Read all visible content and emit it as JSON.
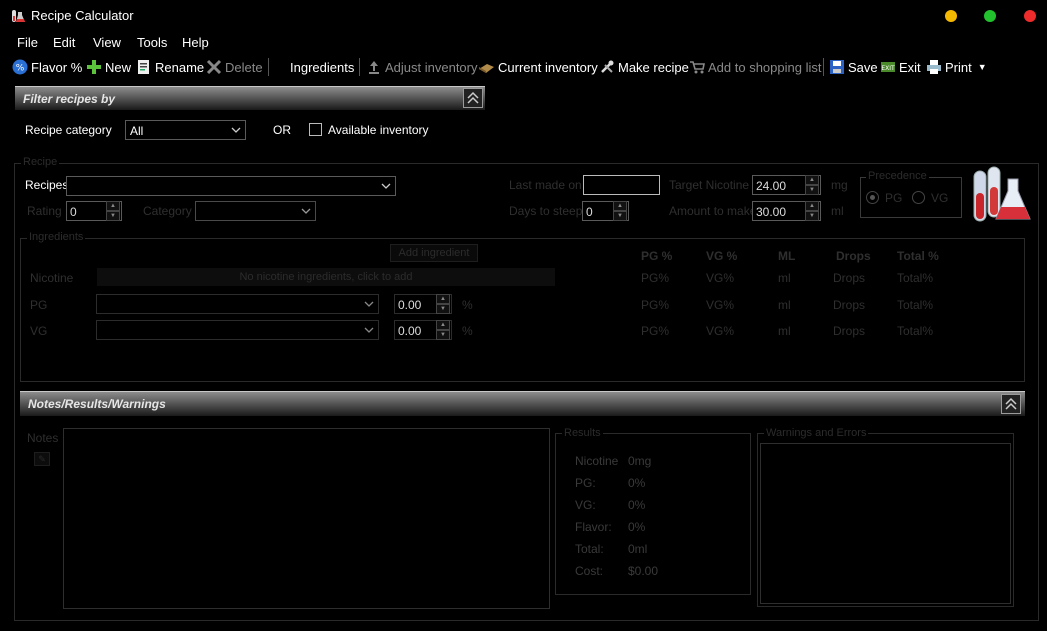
{
  "window": {
    "title": "Recipe Calculator",
    "controls": {
      "minimize_color": "#f5b800",
      "maximize_color": "#22c22e",
      "close_color": "#ee2c2c"
    }
  },
  "menu": [
    "File",
    "Edit",
    "View",
    "Tools",
    "Help"
  ],
  "toolbar": {
    "flavor": "Flavor %",
    "new": "New",
    "rename": "Rename",
    "delete": "Delete",
    "ingredients": "Ingredients",
    "adjust_inventory": "Adjust inventory",
    "current_inventory": "Current inventory",
    "make_recipe": "Make recipe",
    "add_shopping": "Add to shopping list",
    "save": "Save",
    "exit": "Exit",
    "print": "Print"
  },
  "filter": {
    "header": "Filter recipes by",
    "category_label": "Recipe category",
    "category_value": "All",
    "or_label": "OR",
    "available_inventory": "Available inventory"
  },
  "recipe": {
    "group_title": "Recipe",
    "recipes_label": "Recipes",
    "recipes_value": "",
    "rating_label": "Rating",
    "rating_value": "0",
    "category_label": "Category",
    "last_made_label": "Last made on",
    "days_steep_label": "Days to steep",
    "days_steep_value": "0",
    "target_nic_label": "Target Nicotine",
    "target_nic_value": "24.00",
    "target_nic_unit": "mg",
    "amount_label": "Amount to make",
    "amount_value": "30.00",
    "amount_unit": "ml",
    "precedence_title": "Precedence",
    "pg": "PG",
    "vg": "VG"
  },
  "ingredients": {
    "group_title": "Ingredients",
    "add_button": "Add ingredient",
    "columns": [
      "PG %",
      "VG %",
      "ML",
      "Drops",
      "Total %"
    ],
    "nicotine_label": "Nicotine",
    "nicotine_placeholder": "No nicotine ingredients, click to add",
    "pg_label": "PG",
    "vg_label": "VG",
    "pg_value": "0.00",
    "vg_value": "0.00",
    "percent": "%",
    "rows": [
      [
        "PG%",
        "VG%",
        "ml",
        "Drops",
        "Total%"
      ],
      [
        "PG%",
        "VG%",
        "ml",
        "Drops",
        "Total%"
      ],
      [
        "PG%",
        "VG%",
        "ml",
        "Drops",
        "Total%"
      ]
    ]
  },
  "notes": {
    "header": "Notes/Results/Warnings",
    "notes_label": "Notes",
    "results_title": "Results",
    "results": [
      {
        "label": "Nicotine",
        "value": "0mg"
      },
      {
        "label": "PG:",
        "value": "0%"
      },
      {
        "label": "VG:",
        "value": "0%"
      },
      {
        "label": "Flavor:",
        "value": "0%"
      },
      {
        "label": "Total:",
        "value": "0ml"
      },
      {
        "label": "Cost:",
        "value": "$0.00"
      }
    ],
    "warnings_title": "Warnings and Errors"
  }
}
